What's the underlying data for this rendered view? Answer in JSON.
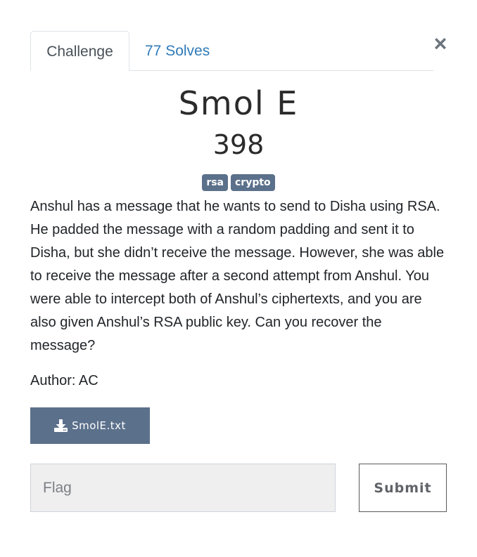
{
  "tabs": {
    "challenge_label": "Challenge",
    "solves_label": "77 Solves"
  },
  "close_symbol": "×",
  "challenge": {
    "name": "Smol E",
    "points": "398",
    "tags": [
      "rsa",
      "crypto"
    ],
    "description": "Anshul has a message that he wants to send to Disha using RSA. He padded the message with a random padding and sent it to Disha, but she didn’t receive the message. However, she was able to receive the message after a second attempt from Anshul. You were able to intercept both of Anshul’s ciphertexts, and you are also given Anshul’s RSA public key. Can you recover the message?",
    "author": "Author: AC"
  },
  "file": {
    "name": "SmolE.txt",
    "icon": "download-icon"
  },
  "flag_form": {
    "placeholder": "Flag",
    "value": "",
    "submit_label": "Submit"
  },
  "colors": {
    "accent": "#5b708b",
    "link": "#2f7ab8"
  }
}
